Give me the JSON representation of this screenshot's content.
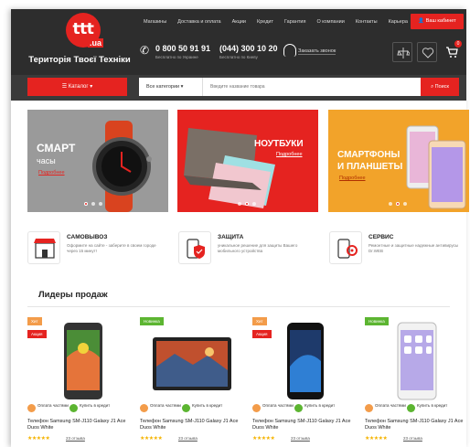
{
  "header": {
    "logo_text": "ttt",
    "logo_domain": ".ua",
    "tagline": "Територія Твоєї Техніки",
    "nav": [
      "Магазины",
      "Доставка и оплата",
      "Акции",
      "Кредит",
      "Гарантия",
      "О компании",
      "Контакты",
      "Карьера"
    ],
    "cabinet": "Ваш кабинет",
    "phone1": "0 800 50 91 91",
    "phone1_note": "Бесплатно по Украине",
    "phone2": "(044) 300 10 20",
    "phone2_note": "Бесплатно по Киеву",
    "callback": "Заказать звонок",
    "cart_count": "0"
  },
  "search": {
    "catalog": "Каталог",
    "category": "Все категории",
    "placeholder": "Введите название товара",
    "button": "Поиск"
  },
  "banners": [
    {
      "title1": "СМАРТ",
      "title2": "часы",
      "link": "Подробнее"
    },
    {
      "title1": "НОУТБУКИ",
      "link": "Подробнее"
    },
    {
      "title1": "СМАРТФОНЫ",
      "title2": "И ПЛАНШЕТЫ",
      "link": "Подробнее"
    }
  ],
  "features": [
    {
      "title": "САМОВЫВОЗ",
      "text": "Оформите на сайте - заберите в своем городе через 15 минут!"
    },
    {
      "title": "ЗАЩИТА",
      "text": "уникальное решение для защиты Вашего мобильного устройства"
    },
    {
      "title": "СЕРВИС",
      "text": "Ремонтные и защитные надежные антивирусы Dr.WEB"
    }
  ],
  "leaders_title": "Лидеры продаж",
  "products": [
    {
      "badge1": "Хит",
      "badge2": "Акция",
      "pay1": "Оплата частями",
      "pay2": "Купить в кредит",
      "name": "Телефон Samsung SM-J110 Galaxy J1 Ace Duos White",
      "stars": "★★★★★",
      "reviews": "23 отзыва"
    },
    {
      "badge1": "Новинка",
      "pay1": "Оплата частями",
      "pay2": "Купить в кредит",
      "name": "Телефон Samsung SM-J110 Galaxy J1 Ace Duos White",
      "stars": "★★★★★",
      "reviews": "23 отзыва"
    },
    {
      "badge1": "Хит",
      "badge2": "Акция",
      "pay1": "Оплата частями",
      "pay2": "Купить в кредит",
      "name": "Телефон Samsung SM-J110 Galaxy J1 Ace Duos White",
      "stars": "★★★★★",
      "reviews": "23 отзыва"
    },
    {
      "badge1": "Новинка",
      "pay1": "Оплата частями",
      "pay2": "Купить в кредит",
      "name": "Телефон Samsung SM-J110 Galaxy J1 Ace Duos White",
      "stars": "★★★★★",
      "reviews": "23 отзыва"
    }
  ],
  "colors": {
    "brand": "#e52320",
    "header_bg": "#2d2d2d",
    "new_badge": "#5cb531",
    "hit_badge": "#f39c4a"
  }
}
